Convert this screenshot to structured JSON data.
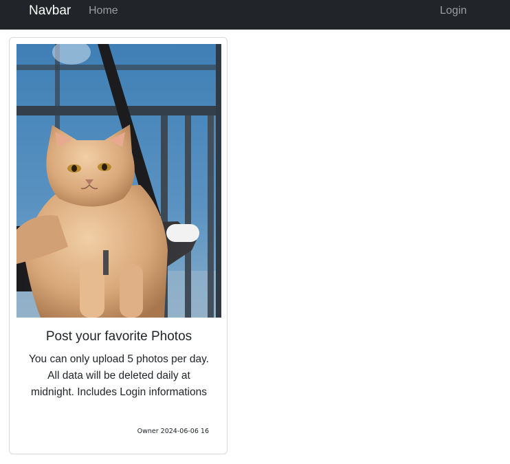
{
  "navbar": {
    "brand": "Navbar",
    "home": "Home",
    "login": "Login"
  },
  "card": {
    "image_subject": "cat-photo",
    "title": "Post your favorite Photos",
    "text": "You can only upload 5 photos per day.  All data will be deleted daily at midnight. Includes Login informations",
    "owner": "Owner",
    "date": "2024-06-06 16"
  },
  "colors": {
    "navbar_bg": "#212529",
    "nav_link": "rgba(255,255,255,0.55)",
    "card_border": "#d7d9dc"
  }
}
